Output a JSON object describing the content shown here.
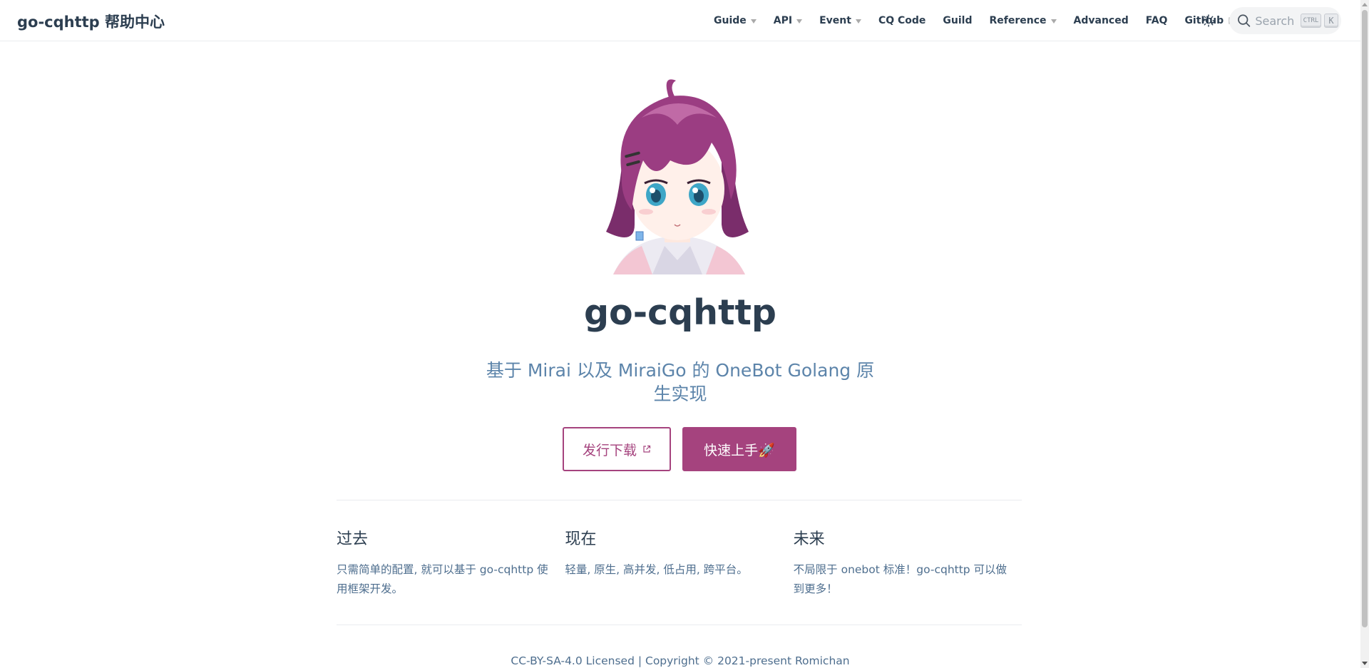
{
  "navbar": {
    "site_name": "go-cqhttp 帮助中心",
    "items": [
      {
        "label": "Guide",
        "dropdown": true
      },
      {
        "label": "API",
        "dropdown": true
      },
      {
        "label": "Event",
        "dropdown": true
      },
      {
        "label": "CQ Code",
        "dropdown": false
      },
      {
        "label": "Guild",
        "dropdown": false
      },
      {
        "label": "Reference",
        "dropdown": true
      },
      {
        "label": "Advanced",
        "dropdown": false
      },
      {
        "label": "FAQ",
        "dropdown": false
      },
      {
        "label": "GitHub",
        "dropdown": false,
        "external": true
      }
    ],
    "search": {
      "placeholder": "Search",
      "key_modifier": "CTRL",
      "key": "K"
    }
  },
  "hero": {
    "title": "go-cqhttp",
    "description": "基于 Mirai 以及 MiraiGo 的 OneBot Golang 原生实现",
    "actions": [
      {
        "label": "发行下载",
        "external": true,
        "style": "secondary"
      },
      {
        "label": "快速上手🚀",
        "style": "primary"
      }
    ]
  },
  "features": [
    {
      "title": "过去",
      "details": "只需简单的配置, 就可以基于 go-cqhttp 使用框架开发。"
    },
    {
      "title": "现在",
      "details": "轻量, 原生, 高并发, 低占用, 跨平台。"
    },
    {
      "title": "未来",
      "details": "不局限于 onebot 标准！go-cqhttp 可以做到更多！"
    }
  ],
  "footer": {
    "text": "CC-BY-SA-4.0 Licensed | Copyright © 2021-present Romichan"
  },
  "colors": {
    "accent": "#a5437e",
    "text": "#2c3e50",
    "description": "#5c84aa"
  }
}
